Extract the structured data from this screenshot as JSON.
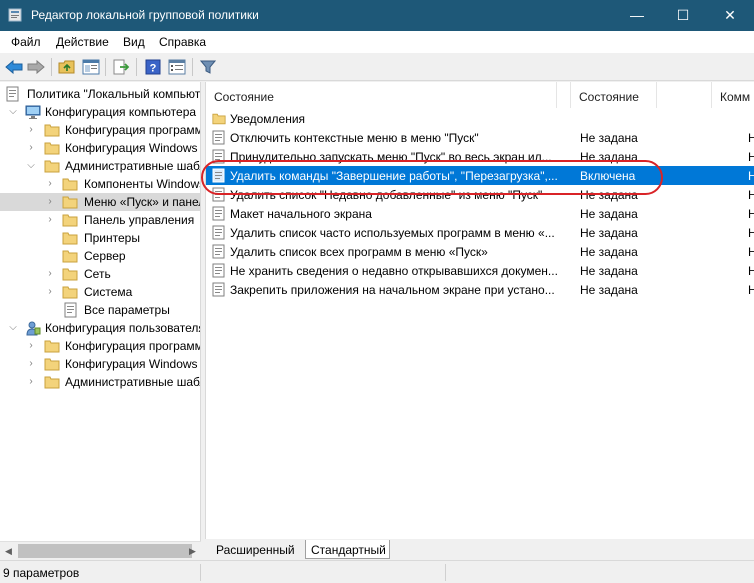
{
  "window": {
    "title": "Редактор локальной групповой политики",
    "minimize_glyph": "—",
    "maximize_glyph": "☐",
    "close_glyph": "✕"
  },
  "menu": {
    "file": "Файл",
    "action": "Действие",
    "view": "Вид",
    "help": "Справка"
  },
  "toolbar": {
    "icons": [
      "back-icon",
      "forward-icon",
      "up-folder-icon",
      "show-hide-tree-icon",
      "export-list-icon",
      "help-icon",
      "properties-icon",
      "filter-icon"
    ]
  },
  "tree": {
    "root": "Политика \"Локальный компьютер\"",
    "computer_config": "Конфигурация компьютера",
    "cc_programs": "Конфигурация программ",
    "cc_windows": "Конфигурация Windows",
    "cc_admin": "Административные шаблоны",
    "cc_admin_components": "Компоненты Windows",
    "cc_admin_start": "Меню «Пуск» и панель задач",
    "cc_admin_control": "Панель управления",
    "cc_admin_printers": "Принтеры",
    "cc_admin_server": "Сервер",
    "cc_admin_network": "Сеть",
    "cc_admin_system": "Система",
    "cc_admin_all": "Все параметры",
    "user_config": "Конфигурация пользователя",
    "uc_programs": "Конфигурация программ",
    "uc_windows": "Конфигурация Windows",
    "uc_admin": "Административные шаблоны"
  },
  "list": {
    "headers": {
      "name": "Состояние",
      "state": "Состояние",
      "comment": "Комм"
    },
    "folder": "Уведомления",
    "rows": [
      {
        "name": "Отключить контекстные меню в меню \"Пуск\"",
        "state": "Не задана",
        "comment": "Нет"
      },
      {
        "name": "Принудительно запускать меню \"Пуск\" во весь экран ил...",
        "state": "Не задана",
        "comment": "Нет"
      },
      {
        "name": "Удалить команды \"Завершение работы\", \"Перезагрузка\",...",
        "state": "Включена",
        "comment": "Нет"
      },
      {
        "name": "Удалить список \"Недавно добавленные\" из меню \"Пуск\"",
        "state": "Не задана",
        "comment": "Нет"
      },
      {
        "name": "Макет начального экрана",
        "state": "Не задана",
        "comment": "Нет"
      },
      {
        "name": "Удалить список часто используемых программ в меню «...",
        "state": "Не задана",
        "comment": "Нет"
      },
      {
        "name": "Удалить список всех программ в меню «Пуск»",
        "state": "Не задана",
        "comment": "Нет"
      },
      {
        "name": "Не хранить сведения о недавно открывавшихся докумен...",
        "state": "Не задана",
        "comment": "Нет"
      },
      {
        "name": "Закрепить приложения на начальном экране при устано...",
        "state": "Не задана",
        "comment": "Нет"
      }
    ]
  },
  "tabs": {
    "extended": "Расширенный",
    "standard": "Стандартный"
  },
  "status": {
    "text": "9 параметров"
  },
  "colors": {
    "titlebar": "#1e5878",
    "selection": "#0078d7",
    "highlight_ring": "#d92327"
  }
}
